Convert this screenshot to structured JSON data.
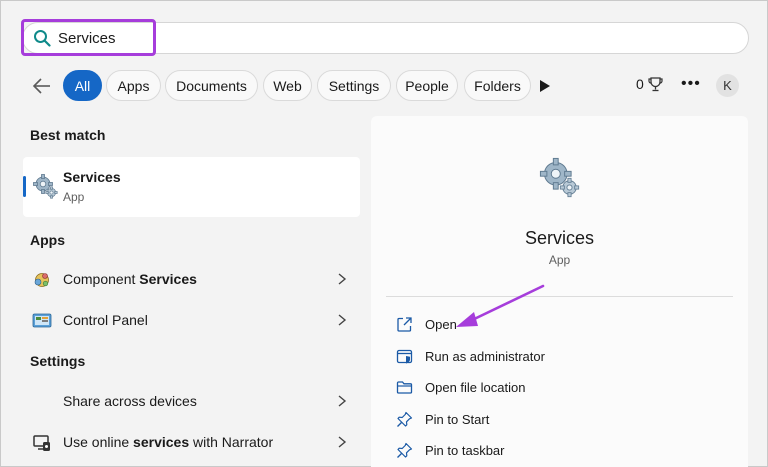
{
  "search": {
    "query": "Services"
  },
  "filters": {
    "chips": [
      {
        "label": "All",
        "active": true
      },
      {
        "label": "Apps"
      },
      {
        "label": "Documents"
      },
      {
        "label": "Web"
      },
      {
        "label": "Settings"
      },
      {
        "label": "People"
      },
      {
        "label": "Folders"
      }
    ],
    "rewards_count": "0",
    "avatar_initial": "K"
  },
  "best_match": {
    "heading": "Best match",
    "title": "Services",
    "subtitle": "App"
  },
  "apps": {
    "heading": "Apps",
    "items": [
      {
        "prefix": "Component ",
        "bold": "Services",
        "suffix": ""
      },
      {
        "prefix": "Control Panel",
        "bold": "",
        "suffix": ""
      }
    ]
  },
  "settings": {
    "heading": "Settings",
    "items": [
      {
        "prefix": "Share across devices",
        "bold": "",
        "suffix": ""
      },
      {
        "prefix": "Use online ",
        "bold": "services",
        "suffix": " with Narrator"
      }
    ]
  },
  "detail": {
    "title": "Services",
    "subtitle": "App",
    "actions": [
      {
        "label": "Open"
      },
      {
        "label": "Run as administrator"
      },
      {
        "label": "Open file location"
      },
      {
        "label": "Pin to Start"
      },
      {
        "label": "Pin to taskbar"
      }
    ]
  },
  "colors": {
    "accent": "#1567c6",
    "highlight": "#a63ddb",
    "annotation_arrow": "#a63ddb"
  }
}
